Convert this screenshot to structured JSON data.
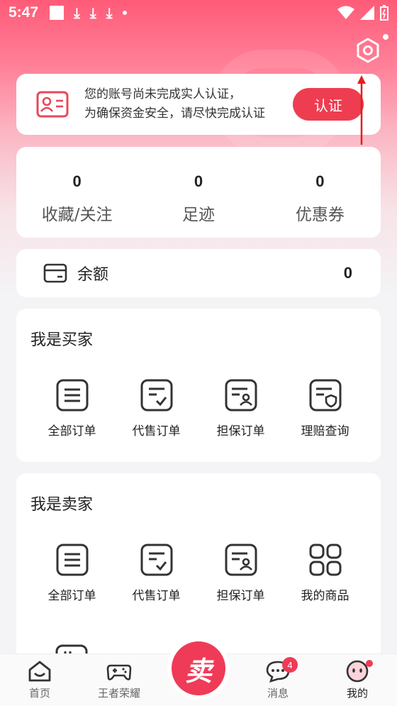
{
  "status_bar": {
    "time": "5:47"
  },
  "verify_card": {
    "line1": "您的账号尚未完成实人认证，",
    "line2": "为确保资金安全，请尽快完成认证",
    "button": "认证"
  },
  "stats": [
    {
      "value": "0",
      "label": "收藏/关注"
    },
    {
      "value": "0",
      "label": "足迹"
    },
    {
      "value": "0",
      "label": "优惠券"
    }
  ],
  "balance": {
    "label": "余额",
    "value": "0"
  },
  "buyer": {
    "title": "我是买家",
    "items": [
      {
        "label": "全部订单",
        "icon": "order-list-icon"
      },
      {
        "label": "代售订单",
        "icon": "order-check-icon"
      },
      {
        "label": "担保订单",
        "icon": "order-person-icon"
      },
      {
        "label": "理赔查询",
        "icon": "order-shield-icon"
      }
    ]
  },
  "seller": {
    "title": "我是卖家",
    "items": [
      {
        "label": "全部订单",
        "icon": "order-list-icon"
      },
      {
        "label": "代售订单",
        "icon": "order-check-icon"
      },
      {
        "label": "担保订单",
        "icon": "order-person-icon"
      },
      {
        "label": "我的商品",
        "icon": "grid-apps-icon"
      }
    ]
  },
  "bottom_nav": {
    "home": "首页",
    "game": "王者荣耀",
    "sell": "卖",
    "messages": "消息",
    "messages_badge": "4",
    "mine": "我的"
  },
  "colors": {
    "accent": "#ee3d50",
    "header": "#ff5b78"
  }
}
